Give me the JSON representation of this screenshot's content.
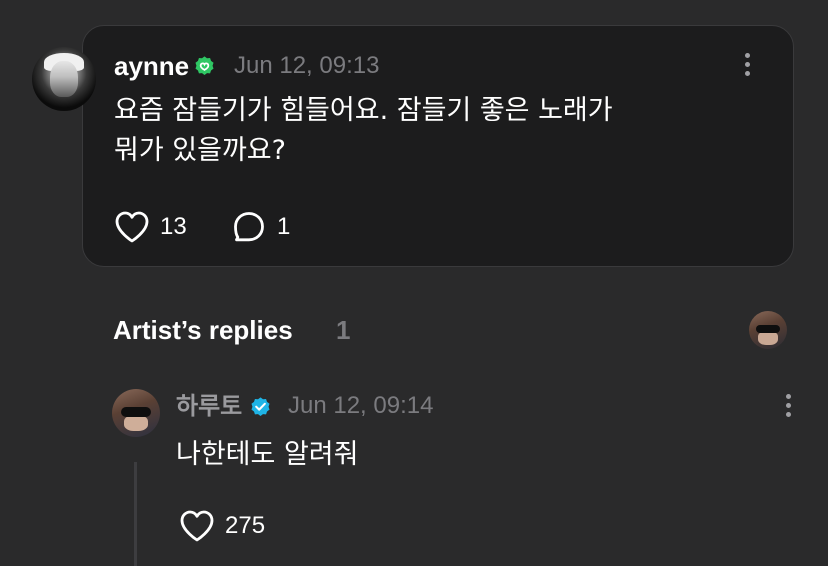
{
  "post": {
    "username": "aynne",
    "timestamp": "Jun 12, 09:13",
    "text": "요즘 잠들기가 힘들어요. 잠들기 좋은 노래가\n뭐가 있을까요?",
    "likes": "13",
    "comments": "1",
    "verified_color": "#2fc764"
  },
  "replies": {
    "title": "Artist’s replies",
    "count": "1",
    "items": [
      {
        "username": "하루토",
        "timestamp": "Jun 12, 09:14",
        "text": "나한테도 알려줘",
        "likes": "275",
        "verified_color": "#1fb4e6"
      }
    ]
  },
  "colors": {
    "background": "#2a2a2b",
    "card": "#1c1c1d",
    "muted": "#7b7b7f"
  }
}
